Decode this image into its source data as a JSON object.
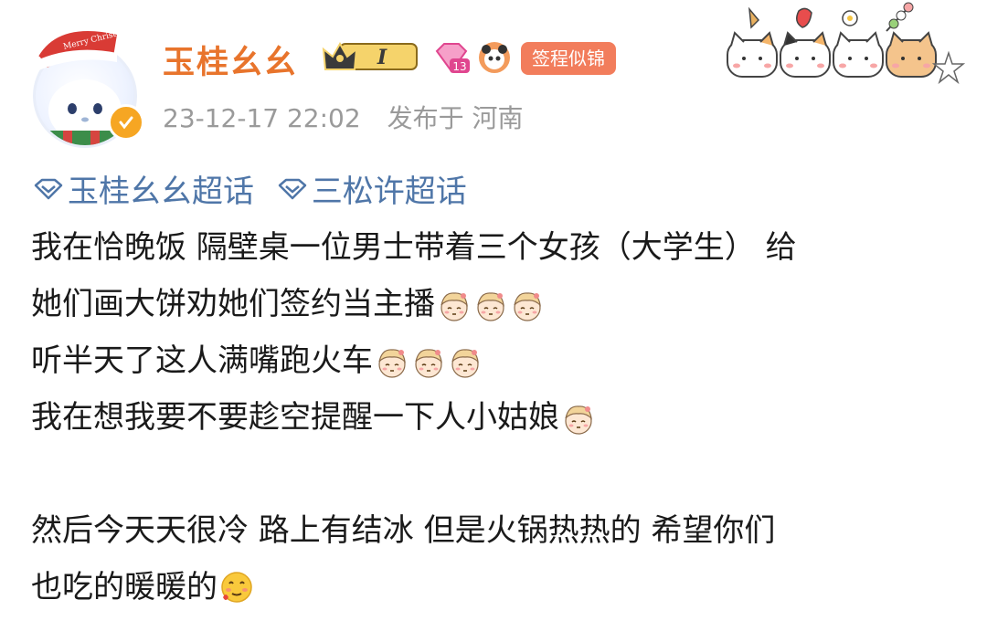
{
  "user": {
    "name": "玉桂幺幺",
    "hat_text": "Merry Christmas",
    "level": "I",
    "gem_level": "13",
    "sign_badge": "签程似锦"
  },
  "post_meta": {
    "time": "23-12-17 22:02",
    "location": "发布于 河南"
  },
  "topics": [
    "玉桂幺幺超话",
    "三松许超话"
  ],
  "body": {
    "line1": "我在恰晚饭 隔壁桌一位男士带着三个女孩（大学生） 给",
    "line2": "她们画大饼劝她们签约当主播",
    "line3": "听半天了这人满嘴跑火车",
    "line4": "我在想我要不要趁空提醒一下人小姑娘",
    "line5": "然后今天天很冷 路上有结冰 但是火锅热热的 希望你们",
    "line6": "也吃的暖暖的"
  },
  "colors": {
    "username": "#e8742c",
    "topic": "#4f76a8",
    "meta": "#9a9a9a",
    "badge": "#f27d5c"
  },
  "icons": [
    "santa-hat-avatar",
    "verified-badge-icon",
    "crown-level-icon",
    "gem-icon",
    "panda-icon",
    "topic-diamond-icon",
    "sticker-girl-icon",
    "drool-face-icon"
  ]
}
